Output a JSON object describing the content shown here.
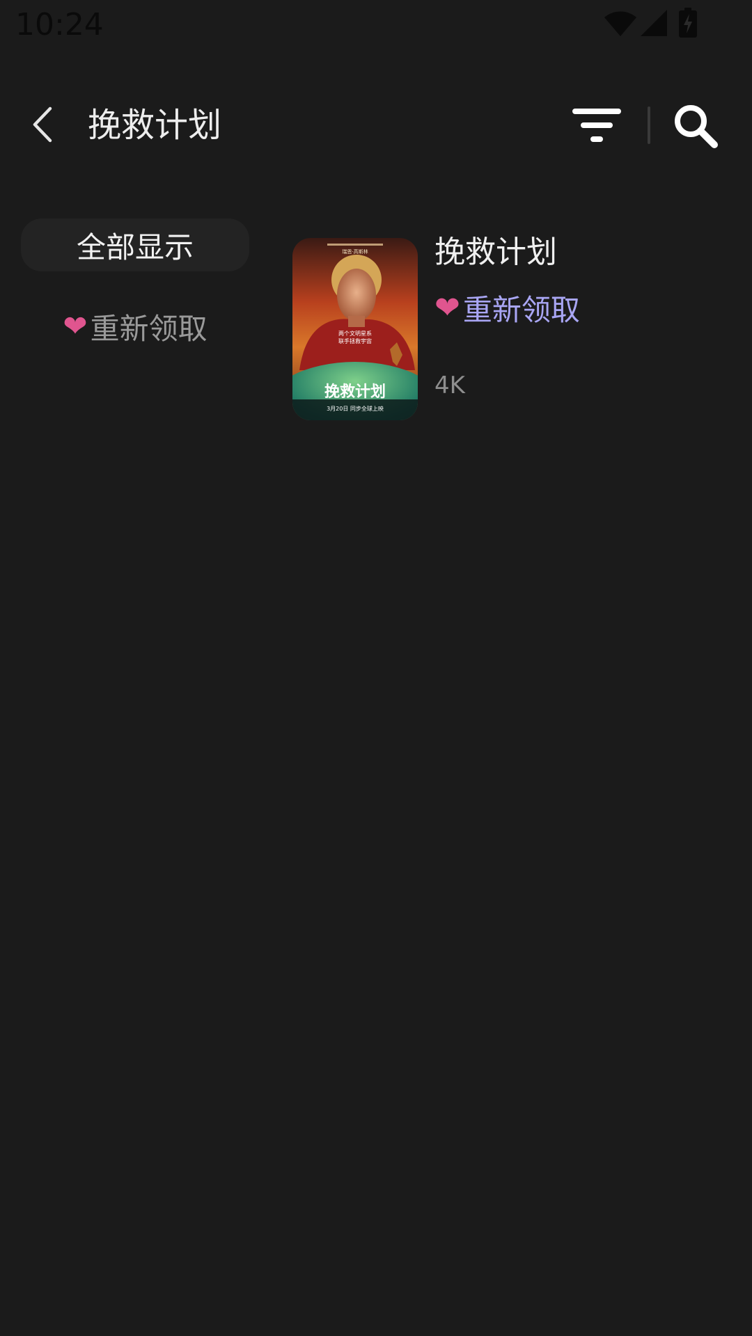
{
  "status_bar": {
    "time": "10:24",
    "icons": [
      "wifi-icon",
      "cellular-signal-icon",
      "battery-charging-icon"
    ]
  },
  "app_bar": {
    "title": "挽救计划",
    "icons": [
      "back-arrow-icon",
      "filter-icon",
      "search-icon"
    ]
  },
  "filters": {
    "all_label": "全部显示",
    "reclaim_label": "重新领取",
    "heart_glyph": "❤"
  },
  "movie": {
    "title": "挽救计划",
    "reclaim_label": "重新领取",
    "heart_glyph": "❤",
    "quality": "4K",
    "poster": {
      "credit": "瑞恩·高斯林",
      "tagline_1": "两个文明星系",
      "tagline_2": "联手拯救宇宙",
      "title_art": "挽救计划",
      "release": "3月20日 同步全球上映"
    }
  },
  "colors": {
    "background": "#1b1b1b",
    "chip_bg": "#232323",
    "heart": "#e0558f",
    "reclaim_accent": "#a9a6f4",
    "muted_text": "#9a9a9a"
  }
}
